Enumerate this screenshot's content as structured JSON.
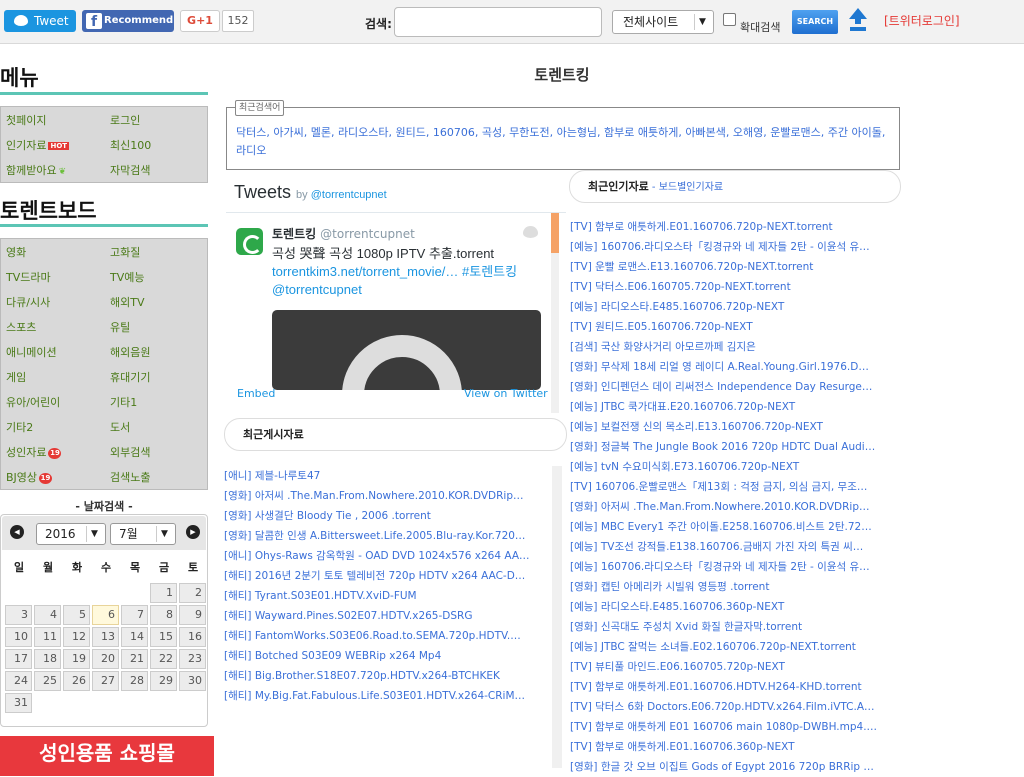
{
  "topbar": {
    "tweet_label": "Tweet",
    "recommend_label": "Recommend",
    "gplus_label": "G+1",
    "gplus_count": "152",
    "search_label": "검색:",
    "search_placeholder": "",
    "site_select": "전체사이트",
    "expand_search_label": "확대검색",
    "search_button": "SEARCH",
    "twitter_login": "[트위터로그인]"
  },
  "sidebar": {
    "menu_title": "메뉴",
    "menu_items": [
      {
        "left": "첫페이지",
        "right": "로그인"
      },
      {
        "left": "인기자료",
        "left_badge": "HOT",
        "right": "최신100"
      },
      {
        "left": "함께받아요",
        "right": "자막검색"
      }
    ],
    "board_title": "토렌트보드",
    "board_items": [
      {
        "left": "영화",
        "right": "고화질"
      },
      {
        "left": "TV드라마",
        "right": "TV예능"
      },
      {
        "left": "다큐/시사",
        "right": "해외TV"
      },
      {
        "left": "스포츠",
        "right": "유틸"
      },
      {
        "left": "애니메이션",
        "right": "해외음원"
      },
      {
        "left": "게임",
        "right": "휴대기기"
      },
      {
        "left": "유아/어린이",
        "right": "기타1"
      },
      {
        "left": "기타2",
        "right": "도서"
      },
      {
        "left": "성인자료",
        "left_badge": "19",
        "right": "외부검색"
      },
      {
        "left": "BJ영상",
        "left_badge": "19",
        "right": "검색노출"
      }
    ]
  },
  "calendar": {
    "title": "- 날짜검색 -",
    "year": "2016",
    "month": "7월",
    "weekdays": [
      "일",
      "월",
      "화",
      "수",
      "목",
      "금",
      "토"
    ],
    "days": [
      1,
      2,
      3,
      4,
      5,
      6,
      7,
      8,
      9,
      10,
      11,
      12,
      13,
      14,
      15,
      16,
      17,
      18,
      19,
      20,
      21,
      22,
      23,
      24,
      25,
      26,
      27,
      28,
      29,
      30,
      31
    ],
    "first_weekday": 5,
    "today": 6
  },
  "shop_banner": "성인용품 쇼핑몰",
  "site_title": "토렌트킹",
  "recent_searches": {
    "legend": "최근검색어",
    "text": "닥터스, 아가씨, 멜론, 라디오스타, 원티드, 160706, 곡성, 무한도전, 아는형님, 함부로 애틋하게, 아빠본색, 오해영, 운빨로맨스, 주간 아이돌, 라디오"
  },
  "twitter": {
    "title": "Tweets",
    "by": "by",
    "by_handle": "@torrentcupnet",
    "author_name": "토렌트킹",
    "author_handle": "@torrentcupnet",
    "tweet_text": "곡성 哭聲  곡성 1080p IPTV 추출.torrent",
    "tweet_link": "torrentkim3.net/torrent_movie/… #토렌트킹 @torrentcupnet",
    "embed": "Embed",
    "view_on_twitter": "View on Twitter"
  },
  "recent_posts": {
    "title": "최근게시자료",
    "items": [
      "[애니] 제블-나루토47",
      "[영화] 아저씨 .The.Man.From.Nowhere.2010.KOR.DVDRip…",
      "[영화] 사생결단 Bloody Tie , 2006 .torrent",
      "[영화] 달콤한 인생 A.Bittersweet.Life.2005.Blu-ray.Kor.720…",
      "[애니] Ohys-Raws 감옥학원 - OAD DVD 1024x576 x264 AA…",
      "[해티] 2016년 2분기 토토 텔레비전 720p HDTV x264 AAC-D…",
      "[해티] Tyrant.S03E01.HDTV.XviD-FUM",
      "[해티] Wayward.Pines.S02E07.HDTV.x265-DSRG",
      "[해티] FantomWorks.S03E06.Road.to.SEMA.720p.HDTV.…",
      "[해티] Botched S03E09 WEBRip x264 Mp4",
      "[해티] Big.Brother.S18E07.720p.HDTV.x264-BTCHKEK",
      "[해티] My.Big.Fat.Fabulous.Life.S03E01.HDTV.x264-CRiM…"
    ]
  },
  "popular": {
    "title": "최근인기자료",
    "sub": " - 보드별인기자료",
    "items": [
      "[TV] 함부로 애틋하게.E01.160706.720p-NEXT.torrent",
      "[예능] 160706.라디오스타「킹경규와 네 제자들 2탄 - 이윤석 유…",
      "[TV] 운빨 로맨스.E13.160706.720p-NEXT.torrent",
      "[TV] 닥터스.E06.160705.720p-NEXT.torrent",
      "[예능] 라디오스타.E485.160706.720p-NEXT",
      "[TV] 원티드.E05.160706.720p-NEXT",
      "[검색] 국산 화양사거리 아모르까페 김지은",
      "[영화] 무삭제 18세 리얼 영 레이디 A.Real.Young.Girl.1976.D…",
      "[영화] 인디펜던스 데이 리써전스 Independence Day Resurge…",
      "[예능] JTBC 쿡가대표.E20.160706.720p-NEXT",
      "[예능] 보컬전쟁 신의 목소리.E13.160706.720p-NEXT",
      "[영화] 정글북 The Jungle Book 2016 720p HDTC Dual Audi…",
      "[예능] tvN 수요미식회.E73.160706.720p-NEXT",
      "[TV] 160706.운빨로맨스「제13회 : 걱정 금지, 의심 금지, 무조…",
      "[영화] 아저씨 .The.Man.From.Nowhere.2010.KOR.DVDRip…",
      "[예능] MBC Every1 주간 아이돌.E258.160706.비스트 2탄.72…",
      "[예능] TV조선 강적들.E138.160706.금배지 가진 자의 특권 씨…",
      "[예능] 160706.라디오스타「킹경규와 네 제자들 2탄 - 이윤석 유…",
      "[영화] 캡틴 아메리카 시빌워 영등평 .torrent",
      "[예능] 라디오스타.E485.160706.360p-NEXT",
      "[영화] 신곡대도 주성치 Xvid 화질 한글자막.torrent",
      "[예능] JTBC 잘먹는 소녀들.E02.160706.720p-NEXT.torrent",
      "[TV] 뷰티풀 마인드.E06.160705.720p-NEXT",
      "[TV] 함부로 애틋하게.E01.160706.HDTV.H264-KHD.torrent",
      "[TV] 닥터스 6화 Doctors.E06.720p.HDTV.x264.Film.iVTC.A…",
      "[TV] 함부로 애틋하게 E01 160706 main 1080p-DWBH.mp4.…",
      "[TV] 함부로 애틋하게.E01.160706.360p-NEXT",
      "[영화] 한글 갓 오브 이집트 Gods of Egypt 2016 720p BRRip …"
    ]
  }
}
